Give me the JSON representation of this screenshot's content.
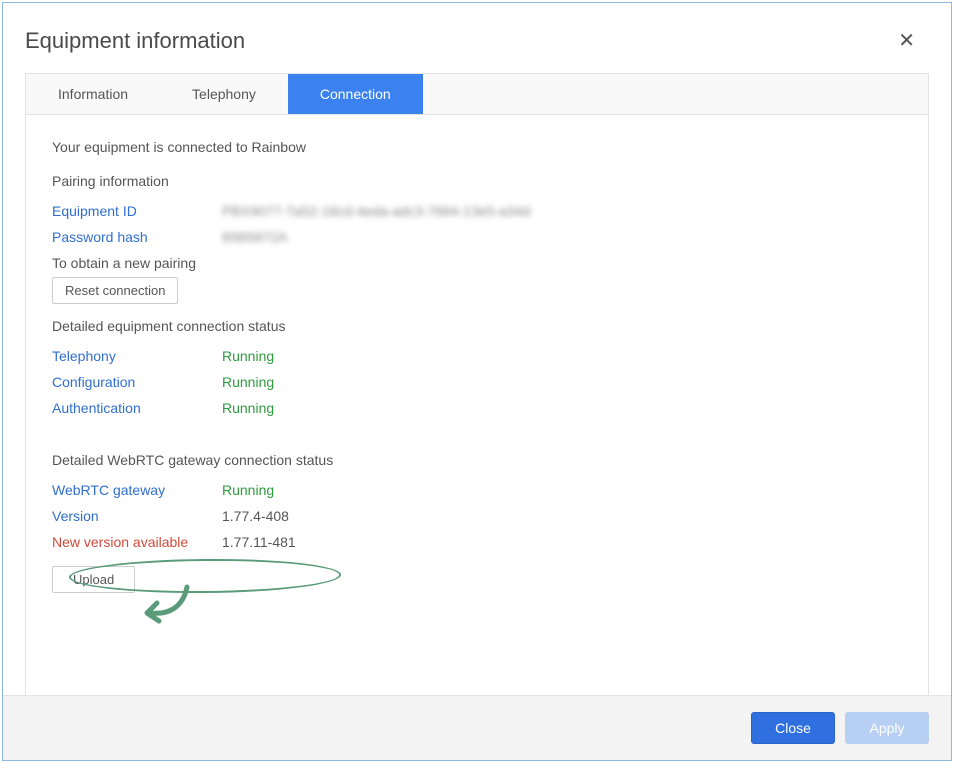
{
  "header": {
    "title": "Equipment information"
  },
  "tabs": [
    {
      "label": "Information",
      "active": false
    },
    {
      "label": "Telephony",
      "active": false
    },
    {
      "label": "Connection",
      "active": true
    }
  ],
  "conn": {
    "status_msg": "Your equipment is connected to Rainbow",
    "pairing_title": "Pairing information",
    "eq_id_label": "Equipment ID",
    "eq_id_value": "PBX9077-7a52-18cd-4eda-adc3-7684-13e5-a34d",
    "pw_label": "Password hash",
    "pw_value": "65B5872A",
    "obtain_text": "To obtain a new pairing",
    "reset_btn": "Reset connection",
    "detailed_title": "Detailed equipment connection status",
    "rows": [
      {
        "label": "Telephony",
        "value": "Running"
      },
      {
        "label": "Configuration",
        "value": "Running"
      },
      {
        "label": "Authentication",
        "value": "Running"
      }
    ],
    "webrtc_title": "Detailed WebRTC gateway connection status",
    "webrtc_rows": {
      "gw_label": "WebRTC gateway",
      "gw_value": "Running",
      "ver_label": "Version",
      "ver_value": "1.77.4-408",
      "newver_label": "New version available",
      "newver_value": "1.77.11-481"
    },
    "upload_btn": "Upload"
  },
  "footer": {
    "close": "Close",
    "apply": "Apply"
  }
}
